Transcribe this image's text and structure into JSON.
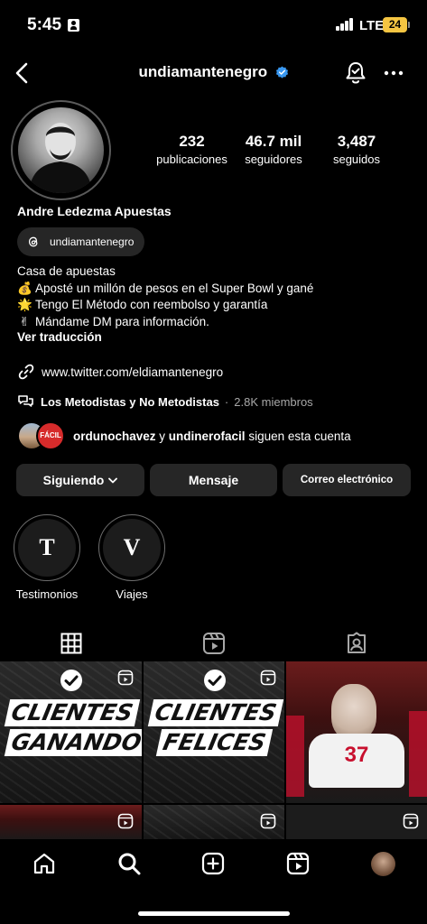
{
  "status": {
    "time": "5:45",
    "network": "LTE",
    "battery": "24"
  },
  "header": {
    "username": "undiamantenegro"
  },
  "stats": [
    {
      "value": "232",
      "label": "publicaciones"
    },
    {
      "value": "46.7 mil",
      "label": "seguidores"
    },
    {
      "value": "3,487",
      "label": "seguidos"
    }
  ],
  "profile": {
    "display_name": "Andre Ledezma Apuestas",
    "threads_handle": "undiamantenegro",
    "bio": [
      {
        "emoji": "",
        "text": "Casa de apuestas"
      },
      {
        "emoji": "💰",
        "text": "Aposté un millón de pesos en el Super Bowl y gané"
      },
      {
        "emoji": "🌟",
        "text": "Tengo El Método con reembolso y garantía"
      },
      {
        "emoji": "✌",
        "text": "Mándame DM para información."
      }
    ],
    "translate": "Ver traducción",
    "link": "www.twitter.com/eldiamantenegro",
    "channel": {
      "name": "Los Metodistas y No Metodistas",
      "separator": "·",
      "members": "2.8K miembros"
    },
    "followed_by": {
      "user1": "ordunochavez",
      "joiner": "y",
      "user2": "undinerofacil",
      "suffix": "siguen esta cuenta",
      "mini_avatar_text": "FÁCIL"
    }
  },
  "actions": {
    "following": "Siguiendo",
    "message": "Mensaje",
    "email": "Correo electrónico"
  },
  "highlights": [
    {
      "glyph": "T",
      "label": "Testimonios"
    },
    {
      "glyph": "V",
      "label": "Viajes"
    }
  ],
  "posts": [
    {
      "line1": "CLIENTES",
      "line2": "GANANDO"
    },
    {
      "line1": "CLIENTES",
      "line2": "FELICES"
    },
    {
      "number": "37"
    }
  ],
  "colors": {
    "background": "#000000",
    "button": "#262626",
    "verified": "#3897f0",
    "secondary_text": "#a8a8a8"
  }
}
